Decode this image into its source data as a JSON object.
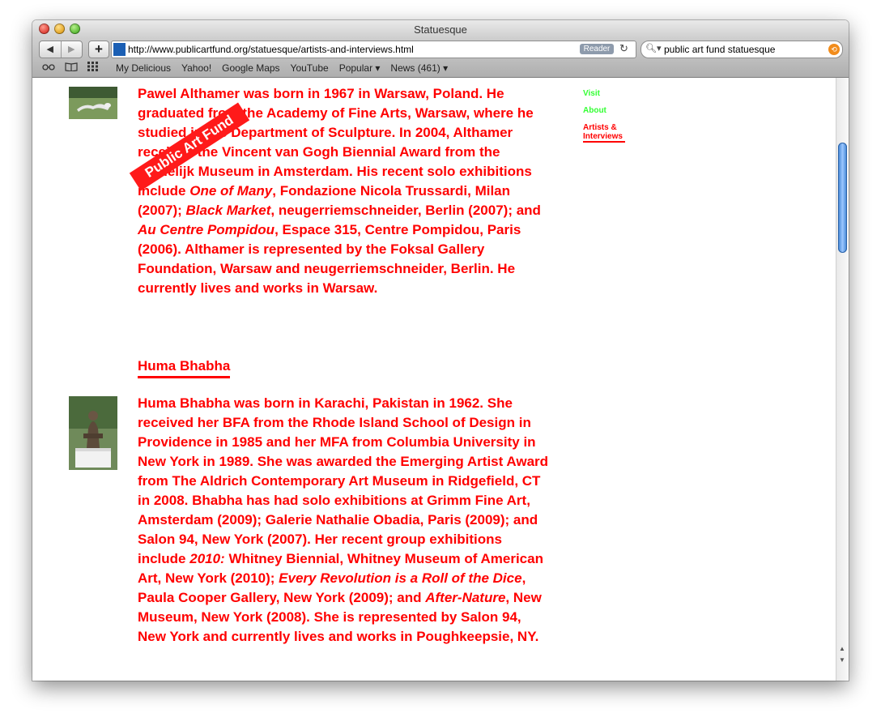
{
  "window": {
    "title": "Statuesque"
  },
  "toolbar": {
    "back_label": "◀",
    "forward_label": "▶",
    "add_label": "+",
    "url": "http://www.publicartfund.org/statuesque/artists-and-interviews.html",
    "reader_label": "Reader",
    "search_value": "public art fund statuesque"
  },
  "bookmarks": {
    "items": [
      "My Delicious",
      "Yahoo!",
      "Google Maps",
      "YouTube",
      "Popular ▾",
      "News (461) ▾"
    ]
  },
  "stamp": {
    "text": "Public Art Fund"
  },
  "sidebar": {
    "visit": "Visit",
    "about": "About",
    "artists_line1": "Artists &",
    "artists_line2": "Interviews"
  },
  "artists": [
    {
      "name": "",
      "bio": [
        {
          "t": "Pawel Althamer was born in 1967 in Warsaw, Poland. He graduated from the Academy of Fine Arts, Warsaw, where he studied in the Department of Sculpture. In 2004, Althamer received the Vincent van Gogh Biennial Award from the Stedelijk Museum in Amsterdam. His recent solo exhibitions include "
        },
        {
          "t": "One of Many",
          "i": true
        },
        {
          "t": ", Fondazione Nicola Trussardi, Milan (2007); "
        },
        {
          "t": "Black Market",
          "i": true
        },
        {
          "t": ", neugerriemschneider, Berlin (2007); and "
        },
        {
          "t": "Au Centre Pompidou",
          "i": true
        },
        {
          "t": ", Espace 315, Centre Pompidou, Paris (2006). Althamer is represented by the Foksal Gallery Foundation, Warsaw and neugerriemschneider, Berlin. He currently lives and works in Warsaw."
        }
      ]
    },
    {
      "name": "Huma Bhabha",
      "bio": [
        {
          "t": "Huma Bhabha was born in Karachi, Pakistan in 1962. She received her BFA from the Rhode Island School of Design in Providence in 1985 and her MFA from Columbia University in New York in 1989. She was awarded the Emerging Artist Award from The Aldrich Contemporary Art Museum in Ridgefield, CT in 2008. Bhabha has had solo exhibitions at Grimm Fine Art, Amsterdam (2009); Galerie Nathalie Obadia, Paris (2009); and Salon 94, New York (2007). Her recent group exhibitions include "
        },
        {
          "t": "2010:",
          "i": true
        },
        {
          "t": " Whitney Biennial, Whitney Museum of American Art, New York (2010); "
        },
        {
          "t": "Every Revolution is a Roll of the Dice",
          "i": true
        },
        {
          "t": ", Paula Cooper Gallery, New York (2009); and "
        },
        {
          "t": "After-Nature",
          "i": true
        },
        {
          "t": ", New Museum, New York (2008). She is represented by Salon 94, New York and currently lives and works in Poughkeepsie, NY."
        }
      ]
    }
  ]
}
